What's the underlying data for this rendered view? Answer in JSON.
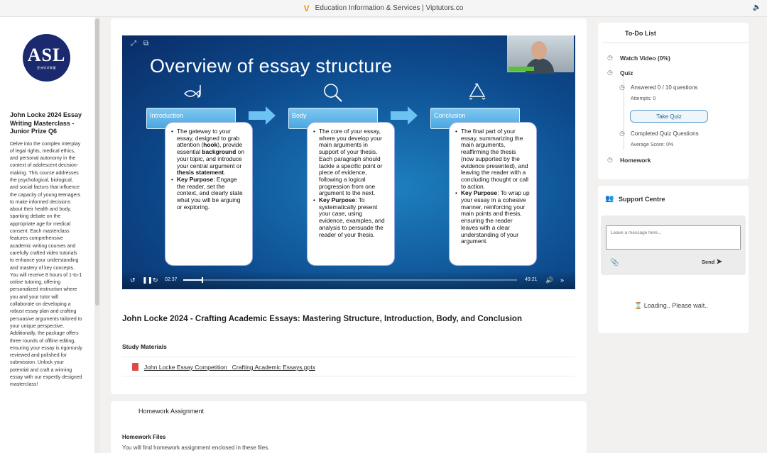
{
  "topbar": {
    "title": "Education Information & Services | Viptutors.co"
  },
  "sidebar": {
    "logo_text": "ASL",
    "logo_sub": "亚洲学术联盟",
    "course_title": "John Locke 2024 Essay Writing Masterclass - Junior Prize Q6",
    "course_desc": "Delve into the complex interplay of legal rights, medical ethics, and personal autonomy in the context of adolescent decision-making. This course addresses the psychological, biological, and social factors that influence the capacity of young teenagers to make informed decisions about their health and body, sparking debate on the appropriate age for medical consent. Each masterclass features comprehensive academic writing courses and carefully crafted video tutorials to enhance your understanding and mastery of key concepts. You will receive 8 hours of 1-to-1 online tutoring, offering personalized instruction where you and your tutor will collaborate on developing a robust essay plan and crafting persuasive arguments tailored to your unique perspective. Additionally, the package offers three rounds of offline editing, ensuring your essay is rigorously reviewed and polished for submission. Unlock your potential and craft a winning essay with our expertly designed masterclass!"
  },
  "video": {
    "slide_title": "Overview of essay structure",
    "current_time": "02:37",
    "total_time": "49:21",
    "progress": 0.055,
    "sections": [
      {
        "head": "Introduction",
        "p1_a": "The gateway to your essay, designed to grab attention (",
        "p1_hook": "hook",
        "p1_b": "), provide essential ",
        "p1_bg": "background",
        "p1_c": " on your topic, and introduce your central argument or ",
        "p1_thesis": "thesis statement",
        "p1_d": ".",
        "kp_label": "Key Purpose",
        "kp_text": ": Engage the reader, set the context, and clearly state what you will be arguing or exploring."
      },
      {
        "head": "Body",
        "p1": "The core of your essay, where you develop your main arguments in support of your thesis. Each paragraph should tackle a specific point or piece of evidence, following a logical progression from one argument to the next.",
        "kp_label": "Key Purpose",
        "kp_text": ": To systematically present your case, using evidence, examples, and analysis to persuade the reader of your thesis."
      },
      {
        "head": "Conclusion",
        "p1": "The final part of your essay, summarizing the main arguments, reaffirming the thesis (now supported by the evidence presented), and leaving the reader with a concluding thought or call to action.",
        "kp_label": "Key Purpose",
        "kp_text": ": To wrap up your essay in a cohesive manner, reinforcing your main points and thesis, ensuring the reader leaves with a clear understanding of your argument."
      }
    ]
  },
  "lesson": {
    "title": "John Locke 2024 - Crafting Academic Essays: Mastering Structure, Introduction, Body, and Conclusion",
    "study_label": "Study Materials",
    "file_name": "John Locke Essay Competition_ Crafting Academic Essays.pptx"
  },
  "homework": {
    "title": "Homework Assignment",
    "files_label": "Homework Files",
    "note": "You will find homework assignment enclosed in these files."
  },
  "todo": {
    "title": "To-Do List",
    "watch": "Watch Video (0%)",
    "quiz": "Quiz",
    "answered": "Answered 0 / 10 questions",
    "attempts": "Attempts: 0",
    "take_quiz": "Take Quiz",
    "completed": "Completed Quiz Questions",
    "avg_score": "Average Score: 0%",
    "homework": "Homework"
  },
  "support": {
    "title": "Support Centre",
    "placeholder": "Leave a message here...",
    "send": "Send",
    "loading": "Loading.. Please wait.."
  }
}
